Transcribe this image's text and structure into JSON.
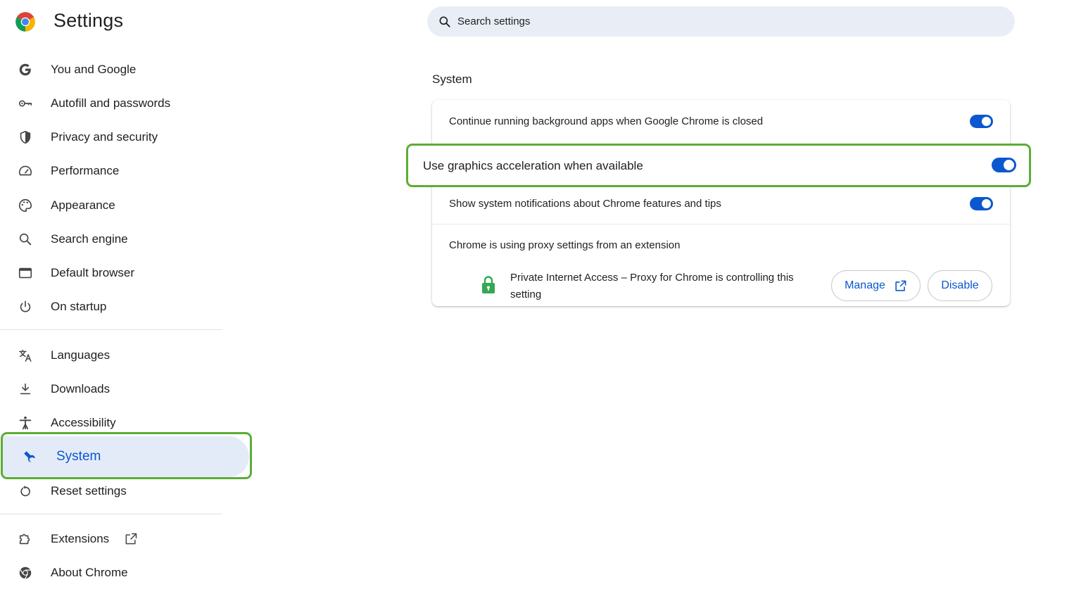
{
  "header": {
    "title": "Settings",
    "search_placeholder": "Search settings"
  },
  "sidebar": {
    "items": [
      {
        "label": "You and Google",
        "icon": "google-g-icon"
      },
      {
        "label": "Autofill and passwords",
        "icon": "key-icon"
      },
      {
        "label": "Privacy and security",
        "icon": "shield-icon"
      },
      {
        "label": "Performance",
        "icon": "speedometer-icon"
      },
      {
        "label": "Appearance",
        "icon": "palette-icon"
      },
      {
        "label": "Search engine",
        "icon": "search-icon"
      },
      {
        "label": "Default browser",
        "icon": "browser-window-icon"
      },
      {
        "label": "On startup",
        "icon": "power-icon"
      },
      {
        "label": "Languages",
        "icon": "translate-icon"
      },
      {
        "label": "Downloads",
        "icon": "download-icon"
      },
      {
        "label": "Accessibility",
        "icon": "accessibility-icon"
      },
      {
        "label": "System",
        "icon": "wrench-icon",
        "selected": true
      },
      {
        "label": "Reset settings",
        "icon": "reset-icon"
      },
      {
        "label": "Extensions",
        "icon": "puzzle-icon"
      },
      {
        "label": "About Chrome",
        "icon": "chrome-icon"
      }
    ]
  },
  "main": {
    "section_title": "System",
    "settings": [
      {
        "label": "Continue running background apps when Google Chrome is closed",
        "enabled": true
      },
      {
        "label": "Use graphics acceleration when available",
        "enabled": true
      },
      {
        "label": "Show system notifications about Chrome features and tips",
        "enabled": true
      }
    ],
    "proxy": {
      "title": "Chrome is using proxy settings from an extension",
      "extension_text": "Private Internet Access – Proxy for Chrome is controlling this setting",
      "manage_label": "Manage",
      "disable_label": "Disable"
    }
  },
  "colors": {
    "accent": "#0b57d0",
    "selected_bg": "#e4ebf8",
    "search_bg": "#e9eef6",
    "highlight": "#5cad34",
    "lock_green": "#34a853"
  }
}
